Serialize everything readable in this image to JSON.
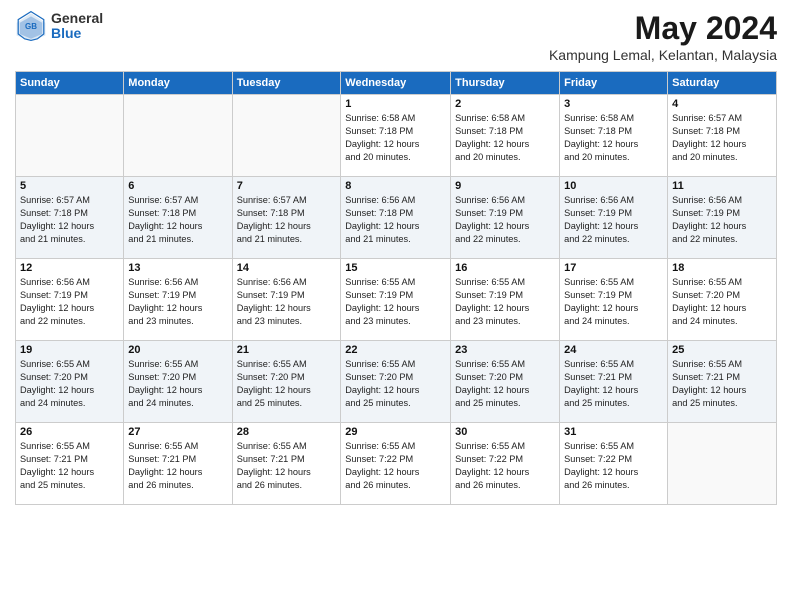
{
  "header": {
    "logo_general": "General",
    "logo_blue": "Blue",
    "month_year": "May 2024",
    "location": "Kampung Lemal, Kelantan, Malaysia"
  },
  "days_of_week": [
    "Sunday",
    "Monday",
    "Tuesday",
    "Wednesday",
    "Thursday",
    "Friday",
    "Saturday"
  ],
  "weeks": [
    [
      {
        "day": "",
        "text": ""
      },
      {
        "day": "",
        "text": ""
      },
      {
        "day": "",
        "text": ""
      },
      {
        "day": "1",
        "text": "Sunrise: 6:58 AM\nSunset: 7:18 PM\nDaylight: 12 hours\nand 20 minutes."
      },
      {
        "day": "2",
        "text": "Sunrise: 6:58 AM\nSunset: 7:18 PM\nDaylight: 12 hours\nand 20 minutes."
      },
      {
        "day": "3",
        "text": "Sunrise: 6:58 AM\nSunset: 7:18 PM\nDaylight: 12 hours\nand 20 minutes."
      },
      {
        "day": "4",
        "text": "Sunrise: 6:57 AM\nSunset: 7:18 PM\nDaylight: 12 hours\nand 20 minutes."
      }
    ],
    [
      {
        "day": "5",
        "text": "Sunrise: 6:57 AM\nSunset: 7:18 PM\nDaylight: 12 hours\nand 21 minutes."
      },
      {
        "day": "6",
        "text": "Sunrise: 6:57 AM\nSunset: 7:18 PM\nDaylight: 12 hours\nand 21 minutes."
      },
      {
        "day": "7",
        "text": "Sunrise: 6:57 AM\nSunset: 7:18 PM\nDaylight: 12 hours\nand 21 minutes."
      },
      {
        "day": "8",
        "text": "Sunrise: 6:56 AM\nSunset: 7:18 PM\nDaylight: 12 hours\nand 21 minutes."
      },
      {
        "day": "9",
        "text": "Sunrise: 6:56 AM\nSunset: 7:19 PM\nDaylight: 12 hours\nand 22 minutes."
      },
      {
        "day": "10",
        "text": "Sunrise: 6:56 AM\nSunset: 7:19 PM\nDaylight: 12 hours\nand 22 minutes."
      },
      {
        "day": "11",
        "text": "Sunrise: 6:56 AM\nSunset: 7:19 PM\nDaylight: 12 hours\nand 22 minutes."
      }
    ],
    [
      {
        "day": "12",
        "text": "Sunrise: 6:56 AM\nSunset: 7:19 PM\nDaylight: 12 hours\nand 22 minutes."
      },
      {
        "day": "13",
        "text": "Sunrise: 6:56 AM\nSunset: 7:19 PM\nDaylight: 12 hours\nand 23 minutes."
      },
      {
        "day": "14",
        "text": "Sunrise: 6:56 AM\nSunset: 7:19 PM\nDaylight: 12 hours\nand 23 minutes."
      },
      {
        "day": "15",
        "text": "Sunrise: 6:55 AM\nSunset: 7:19 PM\nDaylight: 12 hours\nand 23 minutes."
      },
      {
        "day": "16",
        "text": "Sunrise: 6:55 AM\nSunset: 7:19 PM\nDaylight: 12 hours\nand 23 minutes."
      },
      {
        "day": "17",
        "text": "Sunrise: 6:55 AM\nSunset: 7:19 PM\nDaylight: 12 hours\nand 24 minutes."
      },
      {
        "day": "18",
        "text": "Sunrise: 6:55 AM\nSunset: 7:20 PM\nDaylight: 12 hours\nand 24 minutes."
      }
    ],
    [
      {
        "day": "19",
        "text": "Sunrise: 6:55 AM\nSunset: 7:20 PM\nDaylight: 12 hours\nand 24 minutes."
      },
      {
        "day": "20",
        "text": "Sunrise: 6:55 AM\nSunset: 7:20 PM\nDaylight: 12 hours\nand 24 minutes."
      },
      {
        "day": "21",
        "text": "Sunrise: 6:55 AM\nSunset: 7:20 PM\nDaylight: 12 hours\nand 25 minutes."
      },
      {
        "day": "22",
        "text": "Sunrise: 6:55 AM\nSunset: 7:20 PM\nDaylight: 12 hours\nand 25 minutes."
      },
      {
        "day": "23",
        "text": "Sunrise: 6:55 AM\nSunset: 7:20 PM\nDaylight: 12 hours\nand 25 minutes."
      },
      {
        "day": "24",
        "text": "Sunrise: 6:55 AM\nSunset: 7:21 PM\nDaylight: 12 hours\nand 25 minutes."
      },
      {
        "day": "25",
        "text": "Sunrise: 6:55 AM\nSunset: 7:21 PM\nDaylight: 12 hours\nand 25 minutes."
      }
    ],
    [
      {
        "day": "26",
        "text": "Sunrise: 6:55 AM\nSunset: 7:21 PM\nDaylight: 12 hours\nand 25 minutes."
      },
      {
        "day": "27",
        "text": "Sunrise: 6:55 AM\nSunset: 7:21 PM\nDaylight: 12 hours\nand 26 minutes."
      },
      {
        "day": "28",
        "text": "Sunrise: 6:55 AM\nSunset: 7:21 PM\nDaylight: 12 hours\nand 26 minutes."
      },
      {
        "day": "29",
        "text": "Sunrise: 6:55 AM\nSunset: 7:22 PM\nDaylight: 12 hours\nand 26 minutes."
      },
      {
        "day": "30",
        "text": "Sunrise: 6:55 AM\nSunset: 7:22 PM\nDaylight: 12 hours\nand 26 minutes."
      },
      {
        "day": "31",
        "text": "Sunrise: 6:55 AM\nSunset: 7:22 PM\nDaylight: 12 hours\nand 26 minutes."
      },
      {
        "day": "",
        "text": ""
      }
    ]
  ]
}
